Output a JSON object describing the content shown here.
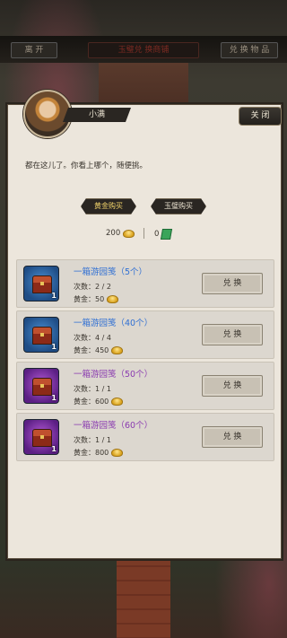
{
  "topbar": {
    "leave_label": "离 开",
    "center_label": "玉璧兑 换商铺",
    "right_label": "兑 换 物 品"
  },
  "npc": {
    "name": "小满",
    "dialog": "都在这儿了。你看上哪个，随便挑。"
  },
  "close_label": "关 闭",
  "tabs": {
    "gold": "黄金购买",
    "jade": "玉璧购买"
  },
  "currency": {
    "gold_amount": "200",
    "jade_amount": "0"
  },
  "items": [
    {
      "title": "一箱游园笺（5个）",
      "count_label": "次数：2 / 2",
      "price_label": "黄金：50",
      "badge": "1",
      "rarity": "blue",
      "button": "兑 换"
    },
    {
      "title": "一箱游园笺（40个）",
      "count_label": "次数：4 / 4",
      "price_label": "黄金：450",
      "badge": "1",
      "rarity": "blue",
      "button": "兑 换"
    },
    {
      "title": "一箱游园笺（50个）",
      "count_label": "次数：1 / 1",
      "price_label": "黄金：600",
      "badge": "1",
      "rarity": "purple",
      "button": "兑 换"
    },
    {
      "title": "一箱游园笺（60个）",
      "count_label": "次数：1 / 1",
      "price_label": "黄金：800",
      "badge": "1",
      "rarity": "purple",
      "button": "兑 换"
    }
  ],
  "colors": {
    "panel": "#ece6dc",
    "blue_title": "#2f6fd3",
    "purple_title": "#8a3bb0"
  }
}
